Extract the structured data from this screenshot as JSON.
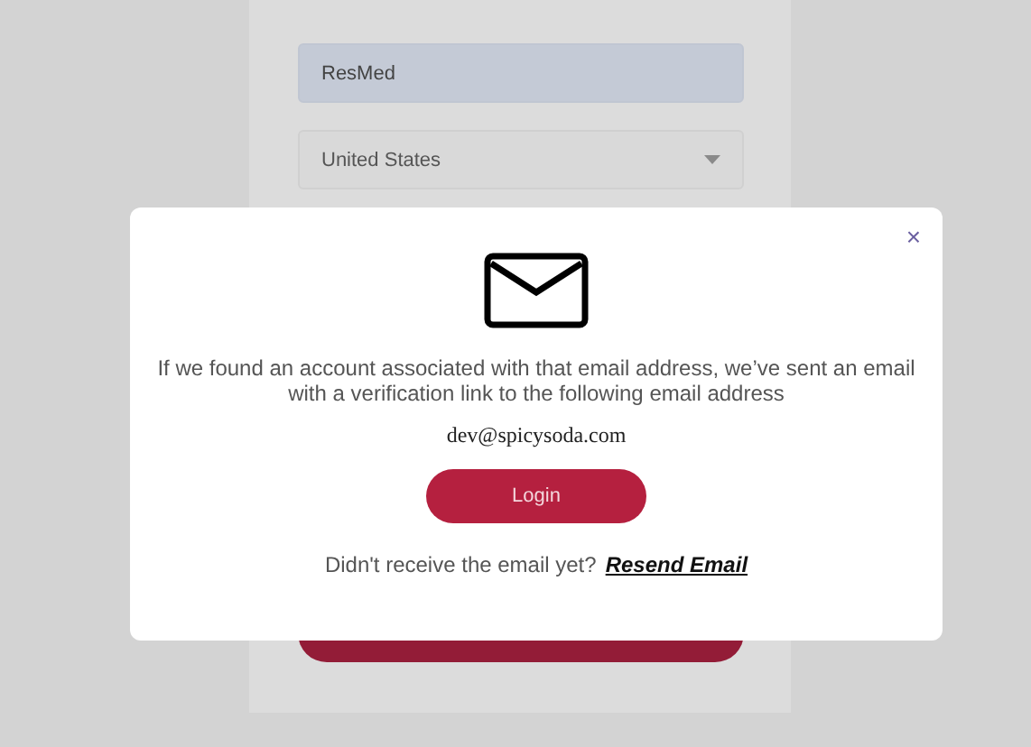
{
  "form": {
    "company": {
      "value": "ResMed"
    },
    "country": {
      "value": "United States"
    }
  },
  "modal": {
    "close": "×",
    "message": "If we found an account associated with that email address, we’ve sent an email with a verification link to the following email address",
    "email": "dev@spicysoda.com",
    "button": "Login",
    "prompt": "Didn't receive the email yet?",
    "link": "Resend Email"
  }
}
